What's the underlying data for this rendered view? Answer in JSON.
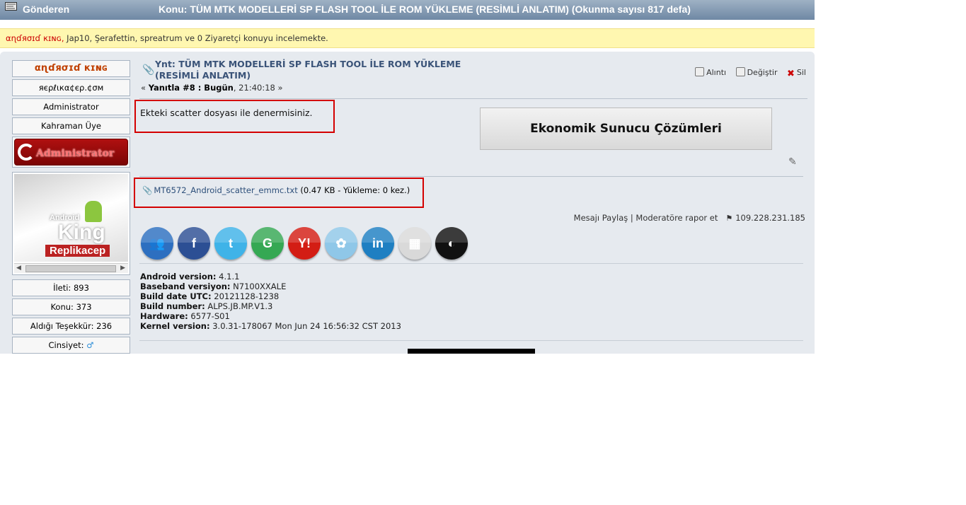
{
  "header": {
    "author_label": "Gönderen",
    "topic_title": "Konu: TÜM MTK MODELLERİ SP FLASH TOOL İLE ROM YÜKLEME (RESİMLİ ANLATIM)  (Okunma sayısı 817 defa)"
  },
  "viewers": {
    "highlight": "αɳɗяσɪɗ кɪɴɢ,",
    "rest": " Jap10, Şerafettin, spreatrum ve 0 Ziyaretçi konuyu incelemekte."
  },
  "sidebar": {
    "username": "αɳɗяσɪɗ кɪɴɢ",
    "website": "яєρℓιкα¢єρ.¢σм",
    "role": "Administrator",
    "title": "Kahraman Üye",
    "rank_image_text": "Administrator",
    "avatar_text": [
      "Android",
      "King",
      "Replikacep"
    ],
    "stats": [
      "İleti: 893",
      "Konu: 373",
      "Aldığı Teşekkür: 236"
    ],
    "gender_label": "Cinsiyet:",
    "gender_symbol": "♂"
  },
  "post": {
    "title": "Ynt: TÜM MTK MODELLERİ SP FLASH TOOL İLE ROM YÜKLEME (RESİMLİ ANLATIM)",
    "meta_prefix": "« ",
    "meta_reply": "Yanıtla #8 : Bugün",
    "meta_time": ", 21:40:18 »",
    "actions": {
      "quote": "Alıntı",
      "modify": "Değiştir",
      "delete": "Sil"
    },
    "message": "Ekteki scatter dosyası ile denermisiniz.",
    "banner": "Ekonomik Sunucu Çözümleri",
    "attachment": {
      "filename": "MT6572_Android_scatter_emmc.txt",
      "info": " (0.47 KB - Yükleme: 0 kez.)"
    },
    "share": "Mesajı Paylaş",
    "separator": " | ",
    "report": "Moderatöre rapor et",
    "ip": "109.228.231.185"
  },
  "social": [
    {
      "name": "myspace-icon",
      "glyph": "👥",
      "color": "#2d6fc0"
    },
    {
      "name": "facebook-icon",
      "glyph": "f",
      "color": "#2c4f94"
    },
    {
      "name": "twitter-icon",
      "glyph": "t",
      "color": "#3fb3e8"
    },
    {
      "name": "google-icon",
      "glyph": "G",
      "color": "#35a853"
    },
    {
      "name": "yahoo-icon",
      "glyph": "Y!",
      "color": "#d31d14"
    },
    {
      "name": "msn-icon",
      "glyph": "✿",
      "color": "#8fc7e8"
    },
    {
      "name": "linkedin-icon",
      "glyph": "in",
      "color": "#1e7fc2"
    },
    {
      "name": "delicious-icon",
      "glyph": "▦",
      "color": "#d9d9d9"
    },
    {
      "name": "delicious2-icon",
      "glyph": "◐",
      "color": "#111111"
    }
  ],
  "signature": [
    {
      "label": "Android version:",
      "value": " 4.1.1"
    },
    {
      "label": "Baseband versiyon:",
      "value": " N7100XXALE"
    },
    {
      "label": "Build date UTC:",
      "value": " 20121128-1238"
    },
    {
      "label": "Build number:",
      "value": " ALPS.JB.MP.V1.3"
    },
    {
      "label": "Hardware:",
      "value": " 6577-S01"
    },
    {
      "label": "Kernel version:",
      "value": " 3.0.31-178067 Mon Jun 24 16:56:32 CST 2013"
    }
  ]
}
